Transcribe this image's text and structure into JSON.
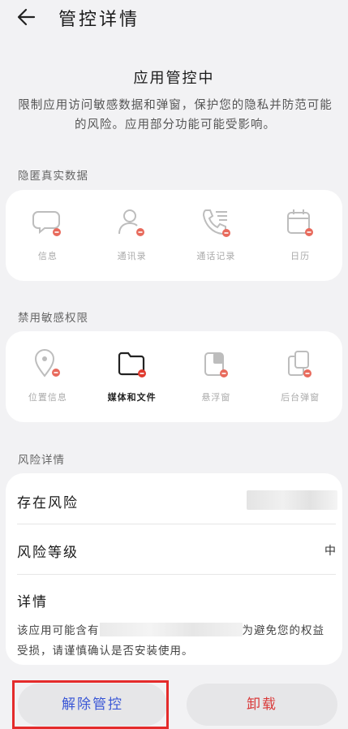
{
  "header": {
    "title": "管控详情",
    "back_icon": "arrow-left-icon"
  },
  "status": {
    "title": "应用管控中",
    "description": "限制应用访问敏感数据和弹窗，保护您的隐私并防范可能的风险。应用部分功能可能受影响。"
  },
  "hidden_data": {
    "label": "隐匿真实数据",
    "items": [
      {
        "label": "信息",
        "icon": "message-icon"
      },
      {
        "label": "通讯录",
        "icon": "contacts-icon"
      },
      {
        "label": "通话记录",
        "icon": "call-log-icon"
      },
      {
        "label": "日历",
        "icon": "calendar-icon"
      }
    ]
  },
  "permissions": {
    "label": "禁用敏感权限",
    "items": [
      {
        "label": "位置信息",
        "icon": "location-icon"
      },
      {
        "label": "媒体和文件",
        "icon": "folder-icon"
      },
      {
        "label": "悬浮窗",
        "icon": "floating-window-icon"
      },
      {
        "label": "后台弹窗",
        "icon": "background-popup-icon"
      }
    ]
  },
  "risk": {
    "label": "风险详情",
    "exists_label": "存在风险",
    "level_label": "风险等级",
    "level_value": "中",
    "detail_label": "详情",
    "detail_text_a": "该应用可能含有",
    "detail_text_b": "为避免您的权益受损，请谨慎确认是否安装使用。"
  },
  "actions": {
    "remove_label": "解除管控",
    "uninstall_label": "卸载"
  },
  "colors": {
    "accent_blue": "#3a57d6",
    "danger_red": "#d93a3a",
    "badge_red": "#e86a5c",
    "highlight_red": "#e42b2b"
  }
}
